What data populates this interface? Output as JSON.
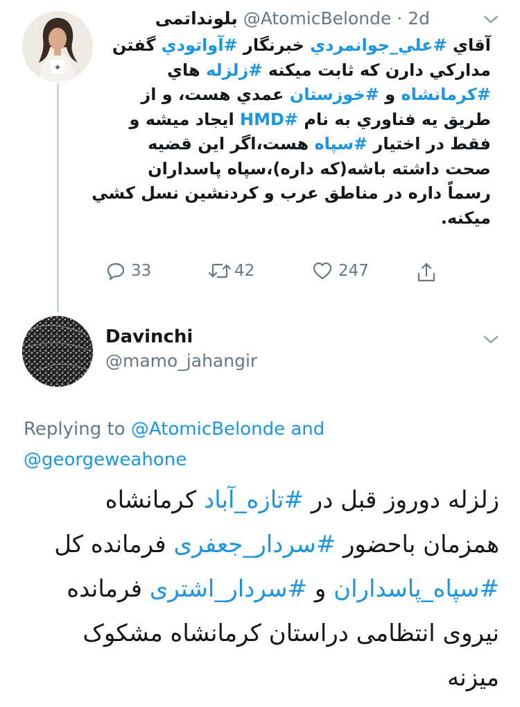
{
  "tweet1": {
    "display_name": "بلوند‌اتمی",
    "handle": "@AtomicBelonde",
    "dot": "·",
    "time": "2d",
    "lines": [
      [
        {
          "t": "آقاي "
        },
        {
          "t": "#علي_جوانمردي",
          "h": true
        },
        {
          "t": " خبرنگار "
        },
        {
          "t": "#آواتودي",
          "h": true
        },
        {
          "t": " گفتن"
        }
      ],
      [
        {
          "t": "مداركي دارن كه ثابت ميكنه "
        },
        {
          "t": "#زلزله",
          "h": true
        },
        {
          "t": " هاي"
        }
      ],
      [
        {
          "t": "#كرمانشاه",
          "h": true
        },
        {
          "t": " و "
        },
        {
          "t": "#خوزستان",
          "h": true
        },
        {
          "t": " عمدي هست، و از"
        }
      ],
      [
        {
          "t": "طريق يه فناوري به نام "
        },
        {
          "t": "#HMD",
          "h": true
        },
        {
          "t": " ايجاد ميشه و"
        }
      ],
      [
        {
          "t": "فقط در اختيار "
        },
        {
          "t": "#سپاه",
          "h": true
        },
        {
          "t": " هست،اگر اين قضيه"
        }
      ],
      [
        {
          "t": "صحت داشته باشه(كه داره)،سپاه پاسداران"
        }
      ],
      [
        {
          "t": "رسماً داره در مناطق عرب و كردنشين نسل كشي"
        }
      ],
      [
        {
          "t": "ميكنه."
        }
      ]
    ],
    "replies": "33",
    "retweets": "42",
    "likes": "247"
  },
  "tweet2": {
    "display_name": "Davinchi",
    "handle": "@mamo_jahangir",
    "replying_prefix": "Replying to",
    "mention1": "@AtomicBelonde",
    "conj": "and",
    "mention2": "@georgeweahone",
    "lines": [
      [
        {
          "t": "زلزله دوروز قبل در "
        },
        {
          "t": "#تازه_آباد",
          "h": true
        },
        {
          "t": " کرمانشاه"
        }
      ],
      [
        {
          "t": "همزمان باحضور "
        },
        {
          "t": "#سردار_جعفری",
          "h": true
        },
        {
          "t": " فرمانده کل"
        }
      ],
      [
        {
          "t": "#سپاه_پاسداران",
          "h": true
        },
        {
          "t": " و "
        },
        {
          "t": "#سردار_اشتری",
          "h": true
        },
        {
          "t": " فرمانده"
        }
      ],
      [
        {
          "t": "نیروی انتظامی دراستان کرمانشاه مشکوک"
        }
      ],
      [
        {
          "t": "میزنه"
        }
      ]
    ]
  },
  "colors": {
    "link": "#1b95e0",
    "secondary": "#657786",
    "text": "#14171a",
    "thread": "#ccd6dd"
  },
  "icons": [
    "reply-icon",
    "retweet-icon",
    "like-icon",
    "share-icon",
    "chevron-down-icon"
  ]
}
